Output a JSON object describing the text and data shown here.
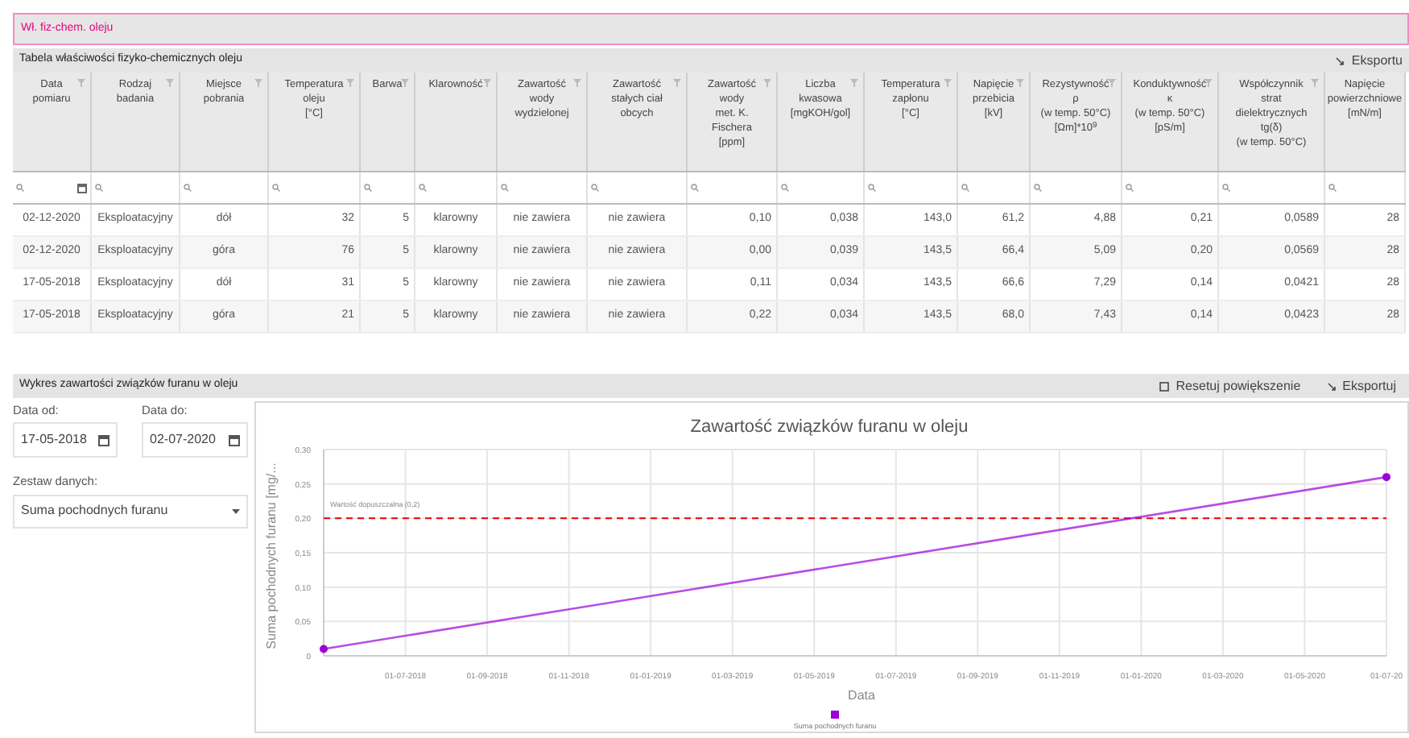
{
  "tab": {
    "label": "Wł. fiz-chem. oleju",
    "selected": true
  },
  "table_panel": {
    "title": "Tabela właściwości fizyko-chemicznych oleju",
    "export": "Eksportu"
  },
  "table": {
    "columns": [
      {
        "label": "Data\npomiaru",
        "filter": true,
        "date_filter": true
      },
      {
        "label": "Rodzaj\nbadania",
        "filter": true
      },
      {
        "label": "Miejsce\npobrania",
        "filter": true
      },
      {
        "label": "Temperatura\noleju\n[°C]",
        "filter": true
      },
      {
        "label": "Barwa",
        "filter": true
      },
      {
        "label": "Klarowność",
        "filter": true
      },
      {
        "label": "Zawartość\nwody\nwydzielonej",
        "filter": true
      },
      {
        "label": "Zawartość\nstałych ciał\nobcych",
        "filter": true
      },
      {
        "label": "Zawartość\nwody\nmet. K.\nFischera\n[ppm]",
        "filter": true
      },
      {
        "label": "Liczba\nkwasowa\n[mgKOH/gol]",
        "filter": true
      },
      {
        "label": "Temperatura\nzapłonu\n[°C]",
        "filter": true
      },
      {
        "label": "Napięcie\nprzebicia\n[kV]",
        "filter": true
      },
      {
        "label": "Rezystywność\nρ\n(w temp. 50°C)\n[Ωm]*10$^{9}$",
        "filter": true
      },
      {
        "label": "Konduktywność\nκ\n(w temp. 50°C)\n[pS/m]",
        "filter": true
      },
      {
        "label": "Współczynnik\nstrat\ndielektrycznych\ntg(δ)\n(w temp. 50°C)",
        "filter": true
      },
      {
        "label": "Napięcie\npowierzchniowe\n[mN/m]",
        "filter": false
      }
    ],
    "rows": [
      [
        "02-12-2020",
        "Eksploatacyjny",
        "dół",
        "32",
        "5",
        "klarowny",
        "nie zawiera",
        "nie zawiera",
        "0,10",
        "0,038",
        "143,0",
        "61,2",
        "4,88",
        "0,21",
        "0,0589",
        "28"
      ],
      [
        "02-12-2020",
        "Eksploatacyjny",
        "góra",
        "76",
        "5",
        "klarowny",
        "nie zawiera",
        "nie zawiera",
        "0,00",
        "0,039",
        "143,5",
        "66,4",
        "5,09",
        "0,20",
        "0,0569",
        "28"
      ],
      [
        "17-05-2018",
        "Eksploatacyjny",
        "dół",
        "31",
        "5",
        "klarowny",
        "nie zawiera",
        "nie zawiera",
        "0,11",
        "0,034",
        "143,5",
        "66,6",
        "7,29",
        "0,14",
        "0,0421",
        "28"
      ],
      [
        "17-05-2018",
        "Eksploatacyjny",
        "góra",
        "21",
        "5",
        "klarowny",
        "nie zawiera",
        "nie zawiera",
        "0,22",
        "0,034",
        "143,5",
        "68,0",
        "7,43",
        "0,14",
        "0,0423",
        "28"
      ]
    ]
  },
  "chart_panel": {
    "title": "Wykres zawartości związków furanu w oleju",
    "reset": "Resetuj powiększenie",
    "export": "Eksportuj"
  },
  "filters": {
    "date_from": {
      "label": "Data od:",
      "value": "17-05-2018"
    },
    "date_to": {
      "label": "Data do:",
      "value": "02-07-2020"
    },
    "dataset": {
      "label": "Zestaw danych:",
      "value": "Suma pochodnych furanu"
    }
  },
  "chart_data": {
    "type": "line",
    "title": "Zawartość związków furanu w oleju",
    "xlabel": "Data",
    "ylabel": "Suma pochodnych furanu [mg/...",
    "categories": [
      null,
      "01-07-2018",
      "01-09-2018",
      "01-11-2018",
      "01-01-2019",
      "01-03-2019",
      "01-05-2019",
      "01-07-2019",
      "01-09-2019",
      "01-11-2019",
      "01-01-2020",
      "01-03-2020",
      "01-05-2020",
      "01-07-20"
    ],
    "grid": true,
    "series": [
      {
        "name": "Suma pochodnych furanu",
        "color": "#9b00d9",
        "marker": "circle",
        "values": [
          0.01,
          null,
          null,
          null,
          null,
          null,
          null,
          null,
          null,
          null,
          null,
          null,
          null,
          0.26
        ]
      }
    ],
    "ylim": [
      0,
      0.3
    ],
    "yticks": [
      {
        "value": 0,
        "label": "0"
      },
      {
        "value": 0.05,
        "label": "0,05"
      },
      {
        "value": 0.1,
        "label": "0,10"
      },
      {
        "value": 0.15,
        "label": "0,15"
      },
      {
        "value": 0.2,
        "label": "0,20"
      },
      {
        "value": 0.25,
        "label": "0,25"
      },
      {
        "value": 0.3,
        "label": "0,30"
      }
    ],
    "ref_lines": [
      {
        "axis": "y",
        "value": 0.2,
        "label": "Wartość dopuszczalna (0,2)",
        "color": "#ee0000"
      }
    ]
  }
}
